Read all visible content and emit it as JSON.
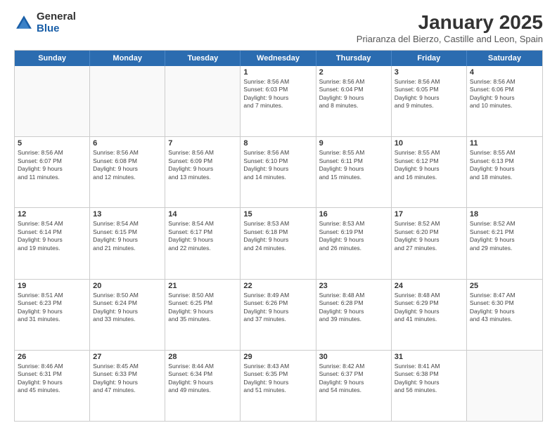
{
  "logo": {
    "general": "General",
    "blue": "Blue"
  },
  "header": {
    "title": "January 2025",
    "subtitle": "Priaranza del Bierzo, Castille and Leon, Spain"
  },
  "calendar": {
    "days": [
      "Sunday",
      "Monday",
      "Tuesday",
      "Wednesday",
      "Thursday",
      "Friday",
      "Saturday"
    ],
    "rows": [
      [
        {
          "day": "",
          "content": ""
        },
        {
          "day": "",
          "content": ""
        },
        {
          "day": "",
          "content": ""
        },
        {
          "day": "1",
          "content": "Sunrise: 8:56 AM\nSunset: 6:03 PM\nDaylight: 9 hours\nand 7 minutes."
        },
        {
          "day": "2",
          "content": "Sunrise: 8:56 AM\nSunset: 6:04 PM\nDaylight: 9 hours\nand 8 minutes."
        },
        {
          "day": "3",
          "content": "Sunrise: 8:56 AM\nSunset: 6:05 PM\nDaylight: 9 hours\nand 9 minutes."
        },
        {
          "day": "4",
          "content": "Sunrise: 8:56 AM\nSunset: 6:06 PM\nDaylight: 9 hours\nand 10 minutes."
        }
      ],
      [
        {
          "day": "5",
          "content": "Sunrise: 8:56 AM\nSunset: 6:07 PM\nDaylight: 9 hours\nand 11 minutes."
        },
        {
          "day": "6",
          "content": "Sunrise: 8:56 AM\nSunset: 6:08 PM\nDaylight: 9 hours\nand 12 minutes."
        },
        {
          "day": "7",
          "content": "Sunrise: 8:56 AM\nSunset: 6:09 PM\nDaylight: 9 hours\nand 13 minutes."
        },
        {
          "day": "8",
          "content": "Sunrise: 8:56 AM\nSunset: 6:10 PM\nDaylight: 9 hours\nand 14 minutes."
        },
        {
          "day": "9",
          "content": "Sunrise: 8:55 AM\nSunset: 6:11 PM\nDaylight: 9 hours\nand 15 minutes."
        },
        {
          "day": "10",
          "content": "Sunrise: 8:55 AM\nSunset: 6:12 PM\nDaylight: 9 hours\nand 16 minutes."
        },
        {
          "day": "11",
          "content": "Sunrise: 8:55 AM\nSunset: 6:13 PM\nDaylight: 9 hours\nand 18 minutes."
        }
      ],
      [
        {
          "day": "12",
          "content": "Sunrise: 8:54 AM\nSunset: 6:14 PM\nDaylight: 9 hours\nand 19 minutes."
        },
        {
          "day": "13",
          "content": "Sunrise: 8:54 AM\nSunset: 6:15 PM\nDaylight: 9 hours\nand 21 minutes."
        },
        {
          "day": "14",
          "content": "Sunrise: 8:54 AM\nSunset: 6:17 PM\nDaylight: 9 hours\nand 22 minutes."
        },
        {
          "day": "15",
          "content": "Sunrise: 8:53 AM\nSunset: 6:18 PM\nDaylight: 9 hours\nand 24 minutes."
        },
        {
          "day": "16",
          "content": "Sunrise: 8:53 AM\nSunset: 6:19 PM\nDaylight: 9 hours\nand 26 minutes."
        },
        {
          "day": "17",
          "content": "Sunrise: 8:52 AM\nSunset: 6:20 PM\nDaylight: 9 hours\nand 27 minutes."
        },
        {
          "day": "18",
          "content": "Sunrise: 8:52 AM\nSunset: 6:21 PM\nDaylight: 9 hours\nand 29 minutes."
        }
      ],
      [
        {
          "day": "19",
          "content": "Sunrise: 8:51 AM\nSunset: 6:23 PM\nDaylight: 9 hours\nand 31 minutes."
        },
        {
          "day": "20",
          "content": "Sunrise: 8:50 AM\nSunset: 6:24 PM\nDaylight: 9 hours\nand 33 minutes."
        },
        {
          "day": "21",
          "content": "Sunrise: 8:50 AM\nSunset: 6:25 PM\nDaylight: 9 hours\nand 35 minutes."
        },
        {
          "day": "22",
          "content": "Sunrise: 8:49 AM\nSunset: 6:26 PM\nDaylight: 9 hours\nand 37 minutes."
        },
        {
          "day": "23",
          "content": "Sunrise: 8:48 AM\nSunset: 6:28 PM\nDaylight: 9 hours\nand 39 minutes."
        },
        {
          "day": "24",
          "content": "Sunrise: 8:48 AM\nSunset: 6:29 PM\nDaylight: 9 hours\nand 41 minutes."
        },
        {
          "day": "25",
          "content": "Sunrise: 8:47 AM\nSunset: 6:30 PM\nDaylight: 9 hours\nand 43 minutes."
        }
      ],
      [
        {
          "day": "26",
          "content": "Sunrise: 8:46 AM\nSunset: 6:31 PM\nDaylight: 9 hours\nand 45 minutes."
        },
        {
          "day": "27",
          "content": "Sunrise: 8:45 AM\nSunset: 6:33 PM\nDaylight: 9 hours\nand 47 minutes."
        },
        {
          "day": "28",
          "content": "Sunrise: 8:44 AM\nSunset: 6:34 PM\nDaylight: 9 hours\nand 49 minutes."
        },
        {
          "day": "29",
          "content": "Sunrise: 8:43 AM\nSunset: 6:35 PM\nDaylight: 9 hours\nand 51 minutes."
        },
        {
          "day": "30",
          "content": "Sunrise: 8:42 AM\nSunset: 6:37 PM\nDaylight: 9 hours\nand 54 minutes."
        },
        {
          "day": "31",
          "content": "Sunrise: 8:41 AM\nSunset: 6:38 PM\nDaylight: 9 hours\nand 56 minutes."
        },
        {
          "day": "",
          "content": ""
        }
      ]
    ]
  }
}
